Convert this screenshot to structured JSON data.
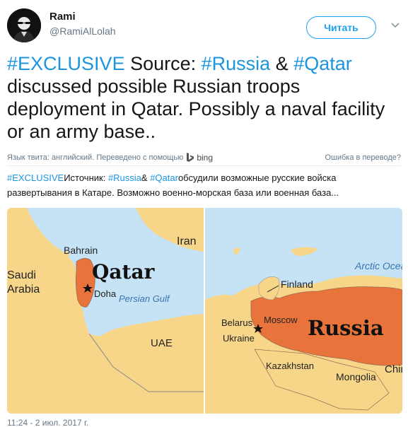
{
  "user": {
    "name": "Rami",
    "handle": "@RamiAlLolah"
  },
  "follow_label": "Читать",
  "tweet": {
    "parts": [
      "#EXCLUSIVE",
      " Source: ",
      "#Russia",
      " & ",
      "#Qatar",
      " discussed possible Russian troops deployment in Qatar. Possibly a naval facility or an army base.."
    ]
  },
  "translation": {
    "info": "Язык твита: английский. Переведено с помощью",
    "provider": "bing",
    "error_link": "Ошибка в переводе?",
    "parts": [
      "#EXCLUSIVE",
      "Источник: ",
      "#Russia",
      "& ",
      "#Qatar",
      "обсудили возможные русские войска развертывания в Катаре. Возможно военно-морская база или военная база..."
    ]
  },
  "map_left": {
    "title": "Qatar",
    "labels": [
      "Bahrain",
      "Iran",
      "Saudi",
      "Arabia",
      "Doha",
      "Persian Gulf",
      "UAE"
    ]
  },
  "map_right": {
    "title": "Russia",
    "labels": [
      "Arctic Ocean",
      "Finland",
      "Belarus",
      "Moscow",
      "Ukraine",
      "Kazakhstan",
      "Mongolia",
      "Chin"
    ]
  },
  "timestamp": "11:24 - 2 июл. 2017 г.",
  "colors": {
    "link": "#1b95e0",
    "button": "#1da1f2",
    "sea": "#c6e3f5",
    "land": "#f7d68a",
    "highlight": "#e8743b"
  }
}
